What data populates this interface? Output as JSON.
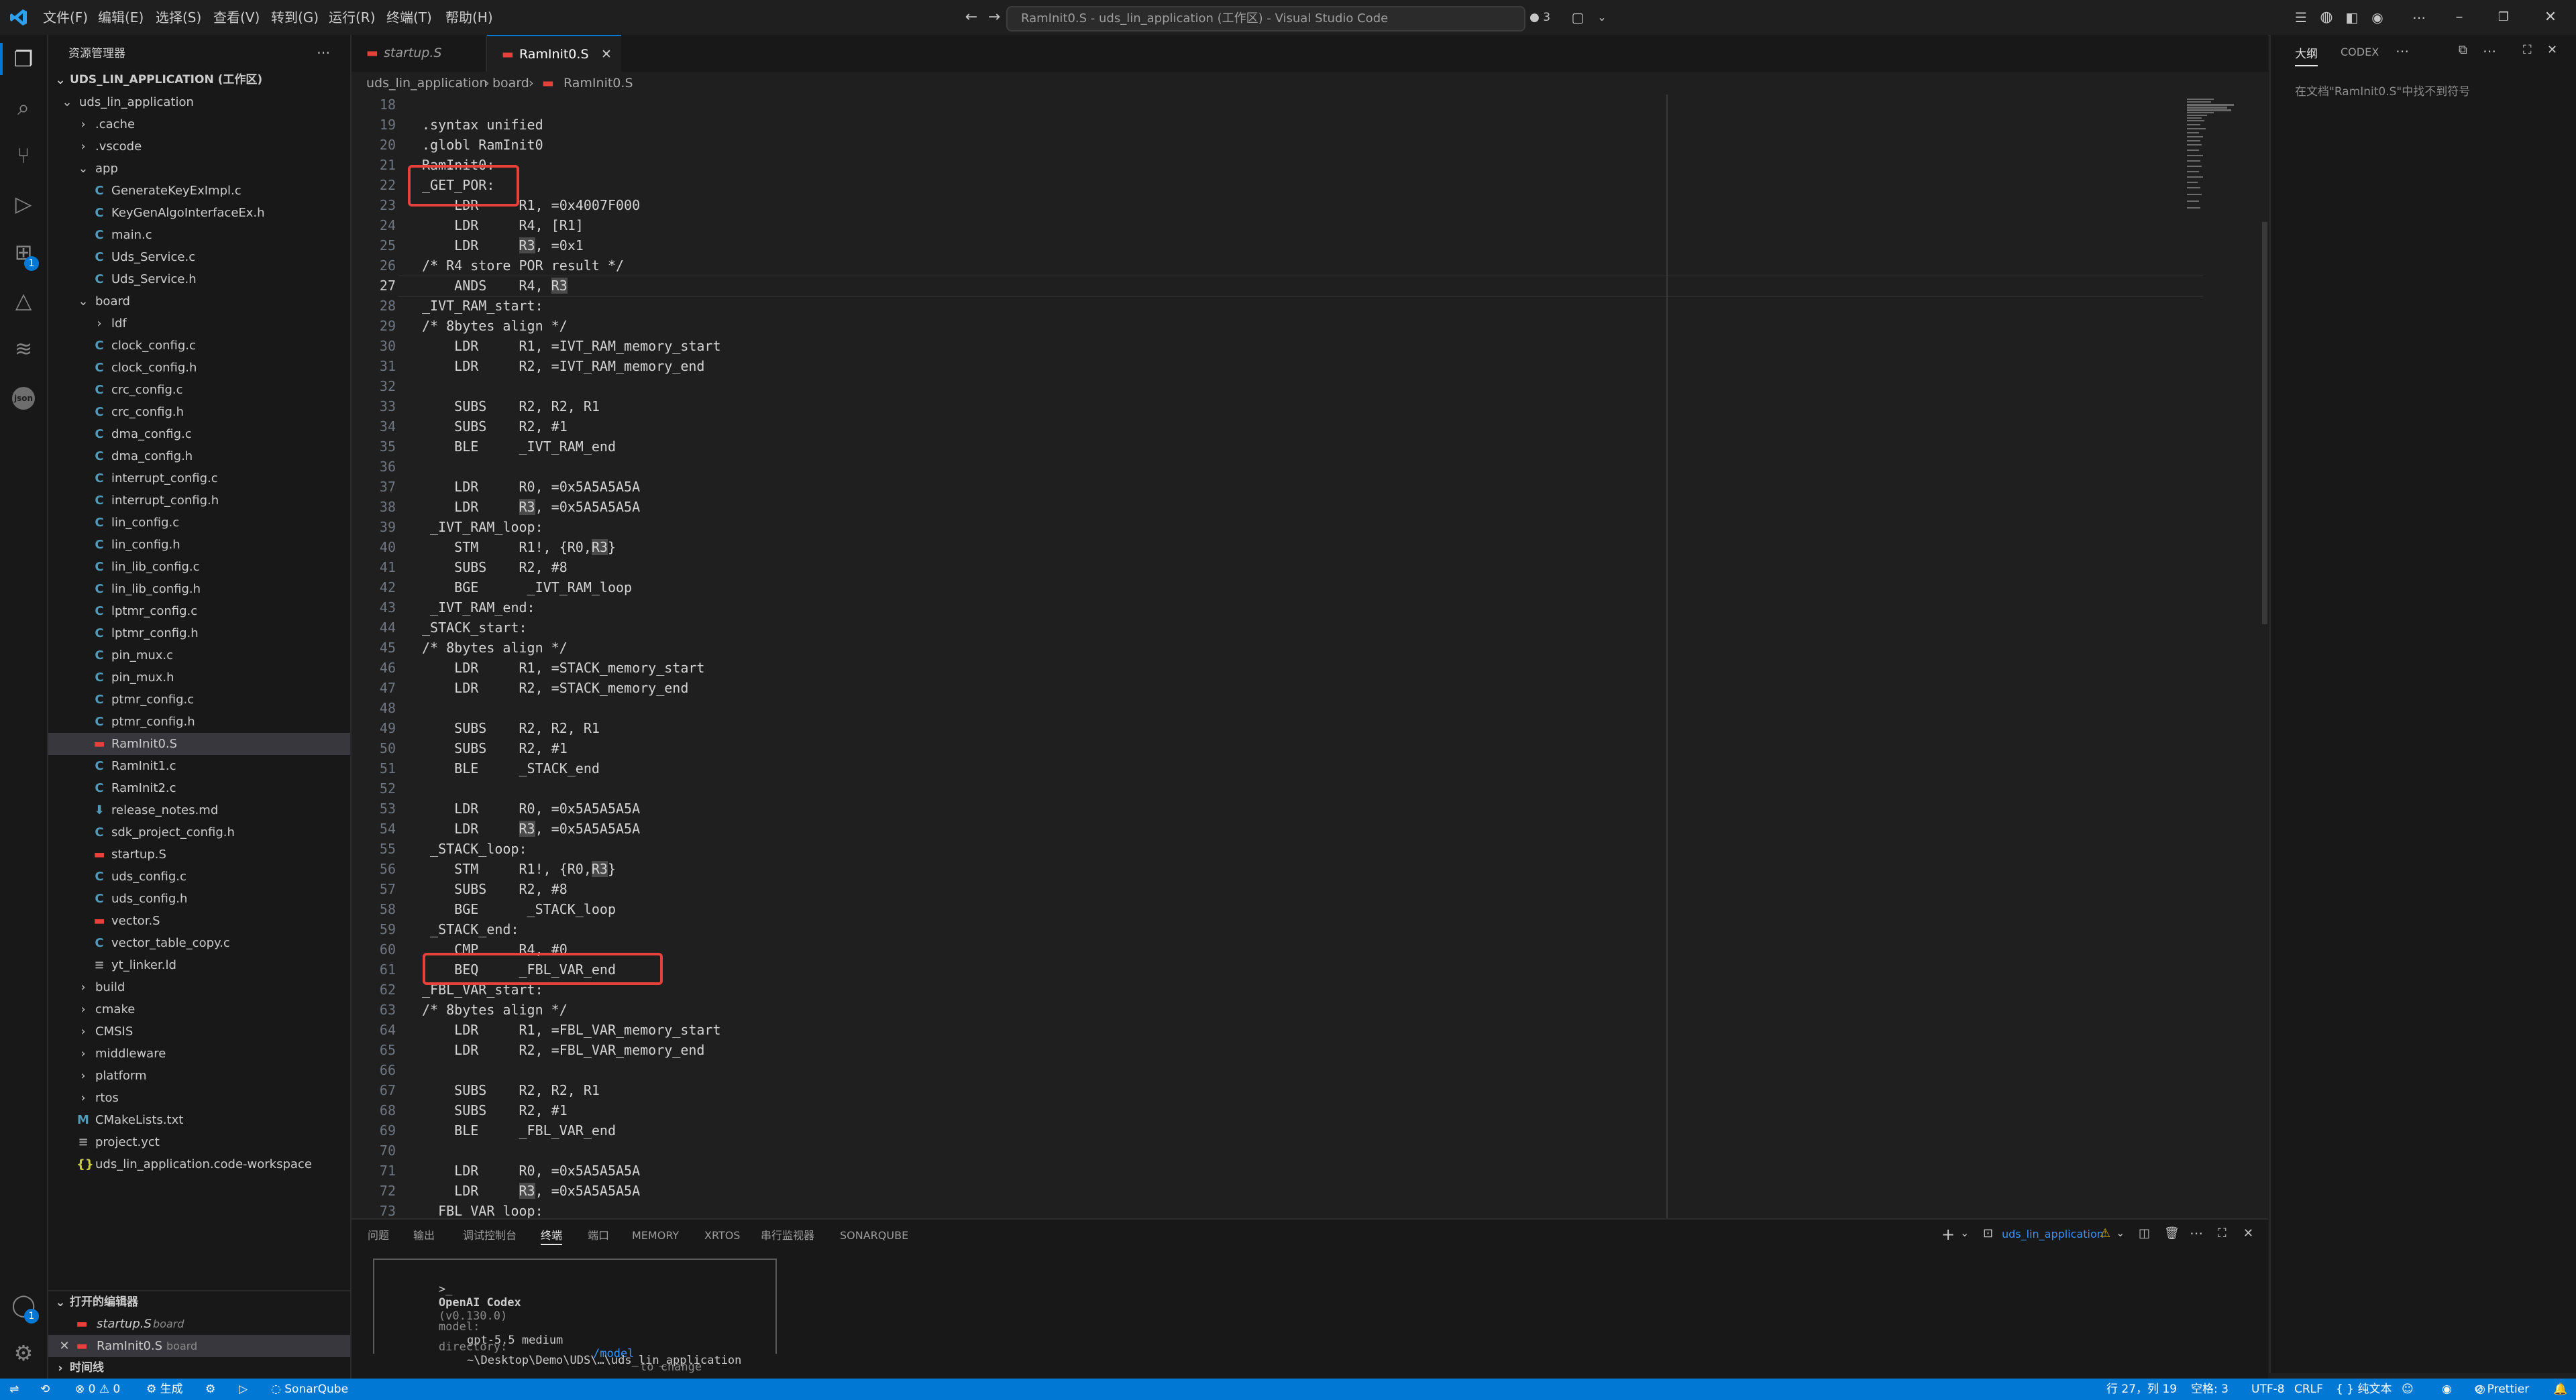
{
  "window": {
    "title": "RamInit0.S - uds_lin_application (工作区) - Visual Studio Code",
    "menu": [
      "文件(F)",
      "编辑(E)",
      "选择(S)",
      "查看(V)",
      "转到(G)",
      "运行(R)",
      "终端(T)",
      "帮助(H)"
    ],
    "session_count": "3"
  },
  "activity_bar": {
    "extensions_badge": "1",
    "accounts_badge": "1"
  },
  "sidebar": {
    "title": "资源管理器",
    "workspace": "UDS_LIN_APPLICATION (工作区)",
    "tree": [
      {
        "label": "uds_lin_application",
        "type": "folder-open",
        "indent": 0
      },
      {
        "label": ".cache",
        "type": "folder",
        "indent": 1
      },
      {
        "label": ".vscode",
        "type": "folder",
        "indent": 1
      },
      {
        "label": "app",
        "type": "folder-open",
        "indent": 1
      },
      {
        "label": "GenerateKeyExImpl.c",
        "type": "c",
        "indent": 2
      },
      {
        "label": "KeyGenAlgoInterfaceEx.h",
        "type": "c",
        "indent": 2
      },
      {
        "label": "main.c",
        "type": "c",
        "indent": 2
      },
      {
        "label": "Uds_Service.c",
        "type": "c",
        "indent": 2
      },
      {
        "label": "Uds_Service.h",
        "type": "c",
        "indent": 2
      },
      {
        "label": "board",
        "type": "folder-open",
        "indent": 1
      },
      {
        "label": "ldf",
        "type": "folder",
        "indent": 2
      },
      {
        "label": "clock_config.c",
        "type": "c",
        "indent": 2
      },
      {
        "label": "clock_config.h",
        "type": "c",
        "indent": 2
      },
      {
        "label": "crc_config.c",
        "type": "c",
        "indent": 2
      },
      {
        "label": "crc_config.h",
        "type": "c",
        "indent": 2
      },
      {
        "label": "dma_config.c",
        "type": "c",
        "indent": 2
      },
      {
        "label": "dma_config.h",
        "type": "c",
        "indent": 2
      },
      {
        "label": "interrupt_config.c",
        "type": "c",
        "indent": 2
      },
      {
        "label": "interrupt_config.h",
        "type": "c",
        "indent": 2
      },
      {
        "label": "lin_config.c",
        "type": "c",
        "indent": 2
      },
      {
        "label": "lin_config.h",
        "type": "c",
        "indent": 2
      },
      {
        "label": "lin_lib_config.c",
        "type": "c",
        "indent": 2
      },
      {
        "label": "lin_lib_config.h",
        "type": "c",
        "indent": 2
      },
      {
        "label": "lptmr_config.c",
        "type": "c",
        "indent": 2
      },
      {
        "label": "lptmr_config.h",
        "type": "c",
        "indent": 2
      },
      {
        "label": "pin_mux.c",
        "type": "c",
        "indent": 2
      },
      {
        "label": "pin_mux.h",
        "type": "c",
        "indent": 2
      },
      {
        "label": "ptmr_config.c",
        "type": "c",
        "indent": 2
      },
      {
        "label": "ptmr_config.h",
        "type": "c",
        "indent": 2
      },
      {
        "label": "RamInit0.S",
        "type": "asm",
        "indent": 2,
        "selected": true
      },
      {
        "label": "RamInit1.c",
        "type": "c",
        "indent": 2
      },
      {
        "label": "RamInit2.c",
        "type": "c",
        "indent": 2
      },
      {
        "label": "release_notes.md",
        "type": "md",
        "indent": 2
      },
      {
        "label": "sdk_project_config.h",
        "type": "c",
        "indent": 2
      },
      {
        "label": "startup.S",
        "type": "asm",
        "indent": 2
      },
      {
        "label": "uds_config.c",
        "type": "c",
        "indent": 2
      },
      {
        "label": "uds_config.h",
        "type": "c",
        "indent": 2
      },
      {
        "label": "vector.S",
        "type": "asm",
        "indent": 2
      },
      {
        "label": "vector_table_copy.c",
        "type": "c",
        "indent": 2
      },
      {
        "label": "yt_linker.ld",
        "type": "ld",
        "indent": 2
      },
      {
        "label": "build",
        "type": "folder",
        "indent": 1
      },
      {
        "label": "cmake",
        "type": "folder",
        "indent": 1
      },
      {
        "label": "CMSIS",
        "type": "folder",
        "indent": 1
      },
      {
        "label": "middleware",
        "type": "folder",
        "indent": 1
      },
      {
        "label": "platform",
        "type": "folder",
        "indent": 1
      },
      {
        "label": "rtos",
        "type": "folder",
        "indent": 1
      },
      {
        "label": "CMakeLists.txt",
        "type": "cmake",
        "indent": 1
      },
      {
        "label": "project.yct",
        "type": "ld",
        "indent": 1
      },
      {
        "label": "uds_lin_application.code-workspace",
        "type": "json",
        "indent": 1
      }
    ],
    "open_editors_title": "打开的编辑器",
    "open_editors": [
      {
        "name": "startup.S",
        "folder": "board"
      },
      {
        "name": "RamInit0.S",
        "folder": "board"
      }
    ],
    "timeline_title": "时间线"
  },
  "tabs": [
    {
      "label": "startup.S",
      "active": false
    },
    {
      "label": "RamInit0.S",
      "active": true
    }
  ],
  "breadcrumb": [
    "uds_lin_application",
    "board",
    "RamInit0.S"
  ],
  "code_lines": [
    {
      "n": "18",
      "text": ""
    },
    {
      "n": "19",
      "text": ".syntax unified"
    },
    {
      "n": "20",
      "text": ".globl RamInit0"
    },
    {
      "n": "21",
      "text": "RamInit0:"
    },
    {
      "n": "22",
      "text": "_GET_POR:"
    },
    {
      "n": "23",
      "text": "    LDR     R1, =0x4007F000"
    },
    {
      "n": "24",
      "text": "    LDR     R4, [R1]"
    },
    {
      "n": "25",
      "text": "    LDR     R3, =0x1"
    },
    {
      "n": "26",
      "text": "/* R4 store POR result */"
    },
    {
      "n": "27",
      "text": "    ANDS    R4, R3"
    },
    {
      "n": "28",
      "text": "_IVT_RAM_start:"
    },
    {
      "n": "29",
      "text": "/* 8bytes align */"
    },
    {
      "n": "30",
      "text": "    LDR     R1, =IVT_RAM_memory_start"
    },
    {
      "n": "31",
      "text": "    LDR     R2, =IVT_RAM_memory_end"
    },
    {
      "n": "32",
      "text": ""
    },
    {
      "n": "33",
      "text": "    SUBS    R2, R2, R1"
    },
    {
      "n": "34",
      "text": "    SUBS    R2, #1"
    },
    {
      "n": "35",
      "text": "    BLE     _IVT_RAM_end"
    },
    {
      "n": "36",
      "text": ""
    },
    {
      "n": "37",
      "text": "    LDR     R0, =0x5A5A5A5A"
    },
    {
      "n": "38",
      "text": "    LDR     R3, =0x5A5A5A5A"
    },
    {
      "n": "39",
      "text": " _IVT_RAM_loop:"
    },
    {
      "n": "40",
      "text": "    STM     R1!, {R0,R3}"
    },
    {
      "n": "41",
      "text": "    SUBS    R2, #8"
    },
    {
      "n": "42",
      "text": "    BGE      _IVT_RAM_loop"
    },
    {
      "n": "43",
      "text": " _IVT_RAM_end:"
    },
    {
      "n": "44",
      "text": "_STACK_start:"
    },
    {
      "n": "45",
      "text": "/* 8bytes align */"
    },
    {
      "n": "46",
      "text": "    LDR     R1, =STACK_memory_start"
    },
    {
      "n": "47",
      "text": "    LDR     R2, =STACK_memory_end"
    },
    {
      "n": "48",
      "text": ""
    },
    {
      "n": "49",
      "text": "    SUBS    R2, R2, R1"
    },
    {
      "n": "50",
      "text": "    SUBS    R2, #1"
    },
    {
      "n": "51",
      "text": "    BLE     _STACK_end"
    },
    {
      "n": "52",
      "text": ""
    },
    {
      "n": "53",
      "text": "    LDR     R0, =0x5A5A5A5A"
    },
    {
      "n": "54",
      "text": "    LDR     R3, =0x5A5A5A5A"
    },
    {
      "n": "55",
      "text": " _STACK_loop:"
    },
    {
      "n": "56",
      "text": "    STM     R1!, {R0,R3}"
    },
    {
      "n": "57",
      "text": "    SUBS    R2, #8"
    },
    {
      "n": "58",
      "text": "    BGE      _STACK_loop"
    },
    {
      "n": "59",
      "text": " _STACK_end:"
    },
    {
      "n": "60",
      "text": "    CMP     R4, #0"
    },
    {
      "n": "61",
      "text": "    BEQ     _FBL_VAR_end"
    },
    {
      "n": "62",
      "text": "_FBL_VAR_start:"
    },
    {
      "n": "63",
      "text": "/* 8bytes align */"
    },
    {
      "n": "64",
      "text": "    LDR     R1, =FBL_VAR_memory_start"
    },
    {
      "n": "65",
      "text": "    LDR     R2, =FBL_VAR_memory_end"
    },
    {
      "n": "66",
      "text": ""
    },
    {
      "n": "67",
      "text": "    SUBS    R2, R2, R1"
    },
    {
      "n": "68",
      "text": "    SUBS    R2, #1"
    },
    {
      "n": "69",
      "text": "    BLE     _FBL_VAR_end"
    },
    {
      "n": "70",
      "text": ""
    },
    {
      "n": "71",
      "text": "    LDR     R0, =0x5A5A5A5A"
    },
    {
      "n": "72",
      "text": "    LDR     R3, =0x5A5A5A5A"
    },
    {
      "n": "73",
      "text": " _FBL_VAR_loop:"
    }
  ],
  "active_line": "27",
  "outline": {
    "tab_outline": "大纲",
    "tab_codex": "CODEX",
    "empty_message": "在文档\"RamInit0.S\"中找不到符号"
  },
  "panel": {
    "tabs": [
      "问题",
      "输出",
      "调试控制台",
      "终端",
      "端口",
      "MEMORY",
      "XRTOS",
      "串行监视器",
      "SONARQUBE"
    ],
    "active_tab": "终端",
    "terminal_name": "uds_lin_application",
    "codex_box": {
      "header_prompt": ">_",
      "header_title": "OpenAI Codex",
      "header_version": "(v0.130.0)",
      "model_label": "model:",
      "model_value": "gpt-5.5 medium",
      "model_cmd": "/model",
      "model_hint": "to change",
      "directory_label": "directory:",
      "directory_value": "~\\Desktop\\Demo\\UDS\\…\\uds_lin_application"
    }
  },
  "status_bar": {
    "errors": "0",
    "warnings": "0",
    "build": "生成",
    "sonar": "SonarQube",
    "cursor": "行 27，列 19",
    "spaces": "空格: 3",
    "encoding": "UTF-8",
    "eol": "CRLF",
    "language": "纯文本",
    "prettier": "Prettier"
  },
  "colors": {
    "accent": "#0078d4",
    "highlight_box": "#e8413b",
    "c_icon": "#519aba",
    "asm_icon": "#e8413b"
  }
}
